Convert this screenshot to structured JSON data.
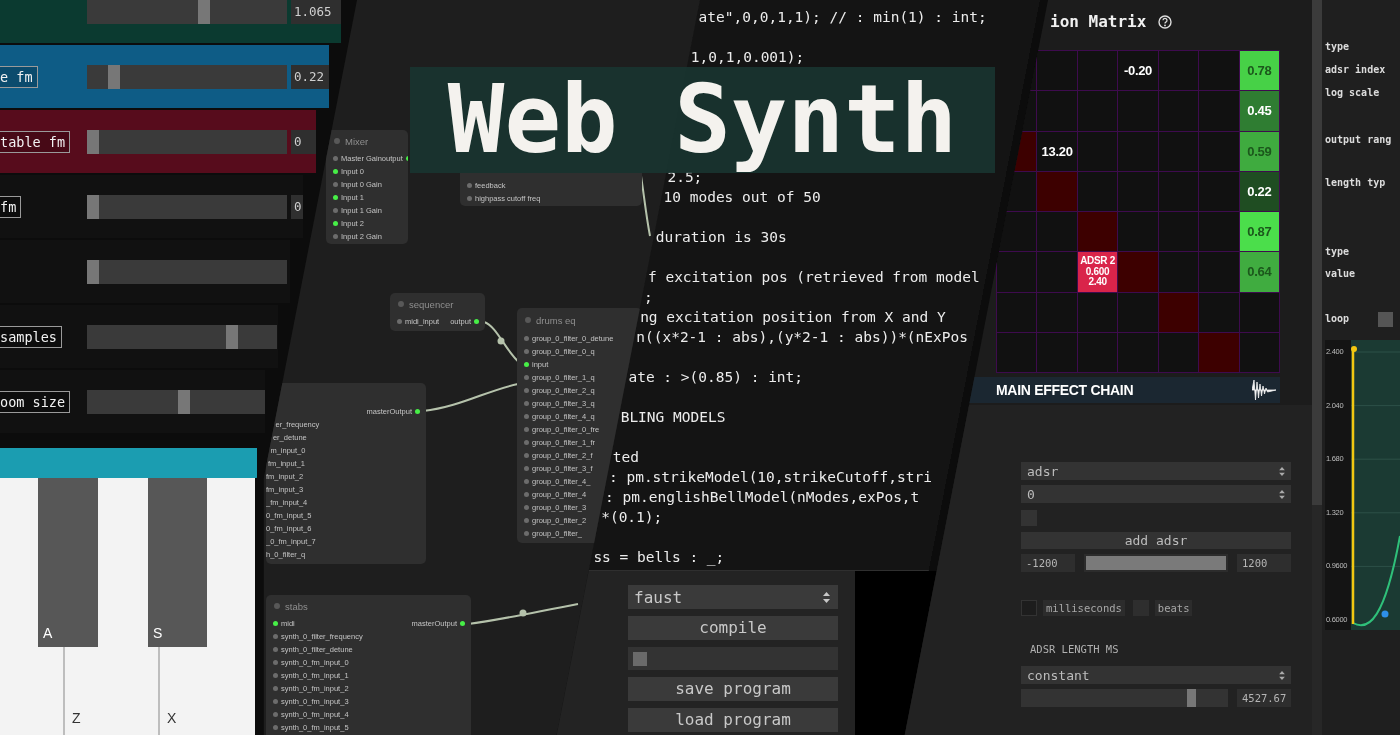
{
  "sliders": {
    "rows": [
      {
        "color": "#0b3a30",
        "level": 0.59,
        "value": "1.065"
      },
      {
        "color": "#0e5c86",
        "label": "e fm",
        "level": 0.11,
        "value": "0.22"
      },
      {
        "color": "#570c1c",
        "label": "table fm",
        "level": 0,
        "value": "0"
      },
      {
        "color": "#111111",
        "label": "fm",
        "level": 0,
        "value": "0"
      },
      {
        "color": "#111111",
        "level": 0
      },
      {
        "color": "#111111",
        "label": "samples",
        "level": 0.78
      },
      {
        "color": "#111111",
        "label": "oom size",
        "level": 0.55
      }
    ]
  },
  "keyboard": {
    "keys": [
      {
        "kind": "white"
      },
      {
        "kind": "black",
        "label": "A"
      },
      {
        "kind": "white",
        "label": "Z"
      },
      {
        "kind": "black",
        "label": "S"
      },
      {
        "kind": "white",
        "label": "X"
      }
    ]
  },
  "node_graph": {
    "nodes": [
      {
        "title": "Mixer",
        "rows": [
          {
            "input": {
              "label": "Master Gain",
              "connected": false
            },
            "output": {
              "label": "output",
              "connected": true
            }
          },
          {
            "input": {
              "label": "Input 0",
              "connected": true
            }
          },
          {
            "input": {
              "label": "Input 0 Gain",
              "connected": false
            }
          },
          {
            "input": {
              "label": "Input 1",
              "connected": true
            }
          },
          {
            "input": {
              "label": "Input 1 Gain",
              "connected": false
            }
          },
          {
            "input": {
              "label": "Input 2",
              "connected": true
            }
          },
          {
            "input": {
              "label": "Input 2 Gain",
              "connected": false
            }
          }
        ]
      },
      {
        "rows": [
          {
            "input": {
              "label": "feedback",
              "connected": false
            }
          },
          {
            "input": {
              "label": "highpass cutoff freq",
              "connected": false
            }
          }
        ]
      },
      {
        "title": "sequencer",
        "rows": [
          {
            "input": {
              "label": "midi_input",
              "connected": false
            },
            "output": {
              "label": "output",
              "connected": true
            }
          }
        ]
      },
      {
        "title": "drums eq",
        "rows": [
          {
            "input": {
              "label": "group_0_filter_0_detune",
              "connected": false
            }
          },
          {
            "input": {
              "label": "group_0_filter_0_q",
              "connected": false
            }
          },
          {
            "input": {
              "label": "input",
              "connected": true
            }
          },
          {
            "input": {
              "label": "group_0_filter_1_q",
              "connected": false
            }
          },
          {
            "input": {
              "label": "group_0_filter_2_q",
              "connected": false
            }
          },
          {
            "input": {
              "label": "group_0_filter_3_q",
              "connected": false
            }
          },
          {
            "input": {
              "label": "group_0_filter_4_q",
              "connected": false
            }
          },
          {
            "input": {
              "label": "group_0_filter_0_fre",
              "connected": false
            }
          },
          {
            "input": {
              "label": "group_0_filter_1_fr",
              "connected": false
            }
          },
          {
            "input": {
              "label": "group_0_filter_2_f",
              "connected": false
            }
          },
          {
            "input": {
              "label": "group_0_filter_3_f",
              "connected": false
            }
          },
          {
            "input": {
              "label": "group_0_filter_4_",
              "connected": false
            }
          },
          {
            "input": {
              "label": "group_0_filter_4",
              "connected": false
            }
          },
          {
            "input": {
              "label": "group_0_filter_3",
              "connected": false
            }
          },
          {
            "input": {
              "label": "group_0_filter_2",
              "connected": false
            }
          },
          {
            "input": {
              "label": "group_0_filter_",
              "connected": false
            }
          }
        ]
      },
      {
        "rows": [
          {
            "output": {
              "label": "masterOutput",
              "connected": true
            }
          },
          {
            "input": {
              "label": "er_frequency"
            }
          },
          {
            "input": {
              "label": "er_detune"
            }
          },
          {
            "input": {
              "label": "m_input_0"
            }
          },
          {
            "input": {
              "label": "fm_input_1"
            }
          },
          {
            "input": {
              "label": "fm_input_2"
            }
          },
          {
            "input": {
              "label": "fm_input_3"
            }
          },
          {
            "input": {
              "label": "_fm_input_4"
            }
          },
          {
            "input": {
              "label": "0_fm_input_5"
            }
          },
          {
            "input": {
              "label": "0_fm_input_6"
            }
          },
          {
            "input": {
              "label": "_0_fm_input_7"
            }
          },
          {
            "input": {
              "label": "h_0_filter_q"
            }
          }
        ]
      },
      {
        "title": "stabs",
        "rows": [
          {
            "input": {
              "label": "midi",
              "connected": true
            },
            "output": {
              "label": "masterOutput",
              "connected": true
            }
          },
          {
            "input": {
              "label": "synth_0_filter_frequency",
              "connected": false
            }
          },
          {
            "input": {
              "label": "synth_0_filter_detune",
              "connected": false
            }
          },
          {
            "input": {
              "label": "synth_0_fm_input_0",
              "connected": false
            }
          },
          {
            "input": {
              "label": "synth_0_fm_input_1",
              "connected": false
            }
          },
          {
            "input": {
              "label": "synth_0_fm_input_2",
              "connected": false
            }
          },
          {
            "input": {
              "label": "synth_0_fm_input_3",
              "connected": false
            }
          },
          {
            "input": {
              "label": "synth_0_fm_input_4",
              "connected": false
            }
          },
          {
            "input": {
              "label": "synth_0_fm_input_5",
              "connected": false
            }
          }
        ]
      }
    ]
  },
  "code_editor": {
    "blocks": [
      "ate\",0,0,1,1); // : min(1) : int;\n\n1,0,1,0.001);",
      "2.5;\n10 modes out of 50\n\nduration is 30s\n\nf excitation pos (retrieved from model\n;\nng excitation position from X and Y\nn((x*2-1 : abs),(y*2-1 : abs))*(nExPos\n\nate : >(0.85) : int;\n\nBLING MODELS\n\nted\n: pm.strikeModel(10,strikeCutoff,stri\n: pm.englishBellModel(nModes,exPos,t\n*(0.1);\n\nss = bells : _;"
    ]
  },
  "compiler_panel": {
    "language_select": {
      "value": "faust"
    },
    "compile_button": "compile",
    "toggle": {
      "checked": false
    },
    "buttons": [
      "save program",
      "load program"
    ]
  },
  "banner": {
    "title": "Web Synth"
  },
  "modulation_matrix": {
    "title": "ion Matrix",
    "rows": [
      [
        {
          "kind": "empty"
        },
        {
          "kind": "empty"
        },
        {
          "kind": "empty"
        },
        {
          "kind": "value",
          "text": "-0.20"
        },
        {
          "kind": "empty"
        },
        {
          "kind": "empty"
        },
        {
          "kind": "tint",
          "color": "#47d147",
          "text": "0.78"
        }
      ],
      [
        {
          "kind": "empty"
        },
        {
          "kind": "empty"
        },
        {
          "kind": "empty"
        },
        {
          "kind": "empty"
        },
        {
          "kind": "empty"
        },
        {
          "kind": "empty"
        },
        {
          "kind": "tint",
          "color": "#2f7d32",
          "text": "0.45"
        }
      ],
      [
        {
          "kind": "tint",
          "color": "#3d0000"
        },
        {
          "kind": "value",
          "text": "13.20"
        },
        {
          "kind": "empty"
        },
        {
          "kind": "empty"
        },
        {
          "kind": "empty"
        },
        {
          "kind": "empty"
        },
        {
          "kind": "tint",
          "color": "#3fab3f",
          "text": "0.59"
        }
      ],
      [
        {
          "kind": "empty"
        },
        {
          "kind": "tint",
          "color": "#3d0000"
        },
        {
          "kind": "empty"
        },
        {
          "kind": "empty"
        },
        {
          "kind": "empty"
        },
        {
          "kind": "empty"
        },
        {
          "kind": "tint",
          "color": "#1f4d22",
          "text": "0.22"
        }
      ],
      [
        {
          "kind": "empty"
        },
        {
          "kind": "empty"
        },
        {
          "kind": "tint",
          "color": "#3d0000"
        },
        {
          "kind": "empty"
        },
        {
          "kind": "empty"
        },
        {
          "kind": "empty"
        },
        {
          "kind": "tint",
          "color": "#4bde4b",
          "text": "0.87"
        }
      ],
      [
        {
          "kind": "empty"
        },
        {
          "kind": "empty"
        },
        {
          "kind": "tint",
          "color": "#d9244a",
          "lines": [
            "ADSR 2",
            "0.600",
            "2.40"
          ]
        },
        {
          "kind": "tint",
          "color": "#3d0000"
        },
        {
          "kind": "empty"
        },
        {
          "kind": "empty"
        },
        {
          "kind": "tint",
          "color": "#40ac40",
          "text": "0.64"
        }
      ],
      [
        {
          "kind": "empty"
        },
        {
          "kind": "empty"
        },
        {
          "kind": "empty"
        },
        {
          "kind": "empty"
        },
        {
          "kind": "tint",
          "color": "#3d0000"
        },
        {
          "kind": "empty"
        },
        {
          "kind": "empty"
        }
      ],
      [
        {
          "kind": "empty"
        },
        {
          "kind": "empty"
        },
        {
          "kind": "empty"
        },
        {
          "kind": "empty"
        },
        {
          "kind": "empty"
        },
        {
          "kind": "tint",
          "color": "#3d0000"
        },
        {
          "kind": "empty"
        }
      ]
    ]
  },
  "effect_chain": {
    "title": "MAIN EFFECT CHAIN"
  },
  "adsr_panel": {
    "type_select": {
      "value": "adsr"
    },
    "index_select": {
      "value": "0"
    },
    "toggle": {
      "checked": false
    },
    "add_button": "add adsr",
    "range": {
      "min": "-1200",
      "level": 1,
      "max": "1200"
    },
    "unit_options": [
      {
        "label": "milliseconds",
        "checked": false
      },
      {
        "label": "beats",
        "checked": false
      }
    ],
    "length_label": "ADSR LENGTH MS",
    "length_select": {
      "value": "constant"
    },
    "length_slider": {
      "level": 0.84,
      "value": "4527.67"
    }
  },
  "properties": {
    "labels": [
      "type",
      "adsr index",
      "log scale",
      "output rang",
      "length typ",
      "type",
      "value"
    ],
    "loop": {
      "label": "loop",
      "checked": false
    }
  },
  "envelope_chart": {
    "y_ticks": [
      "2.400",
      "2.040",
      "1.680",
      "1.320",
      "0.9600",
      "0.6000"
    ]
  }
}
